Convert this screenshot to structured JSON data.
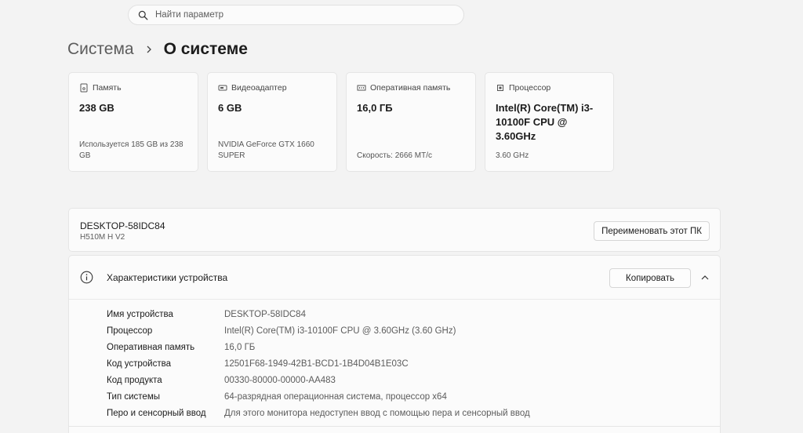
{
  "search": {
    "placeholder": "Найти параметр"
  },
  "breadcrumb": {
    "parent": "Система",
    "current": "О системе"
  },
  "cards": [
    {
      "icon": "storage-icon",
      "title": "Память",
      "value": "238 GB",
      "sub": "Используется 185 GB из 238 GB"
    },
    {
      "icon": "gpu-icon",
      "title": "Видеоадаптер",
      "value": "6 GB",
      "sub": "NVIDIA GeForce GTX 1660 SUPER"
    },
    {
      "icon": "ram-icon",
      "title": "Оперативная память",
      "value": "16,0 ГБ",
      "sub": "Скорость: 2666 МТ/с"
    },
    {
      "icon": "cpu-icon",
      "title": "Процессор",
      "value": "Intel(R) Core(TM) i3-10100F CPU @ 3.60GHz",
      "sub": "3.60 GHz"
    }
  ],
  "device": {
    "name": "DESKTOP-58IDC84",
    "model": "H510M H V2",
    "rename_label": "Переименовать этот ПК"
  },
  "specs": {
    "title": "Характеристики устройства",
    "copy_label": "Копировать",
    "rows": [
      {
        "label": "Имя устройства",
        "value": "DESKTOP-58IDC84"
      },
      {
        "label": "Процессор",
        "value": "Intel(R) Core(TM) i3-10100F CPU @ 3.60GHz (3.60 GHz)"
      },
      {
        "label": "Оперативная память",
        "value": "16,0 ГБ"
      },
      {
        "label": "Код устройства",
        "value": "12501F68-1949-42B1-BCD1-1B4D04B1E03C"
      },
      {
        "label": "Код продукта",
        "value": "00330-80000-00000-AA483"
      },
      {
        "label": "Тип системы",
        "value": "64-разрядная операционная система, процессор x64"
      },
      {
        "label": "Перо и сенсорный ввод",
        "value": "Для этого монитора недоступен ввод с помощью пера и сенсорный ввод"
      }
    ]
  },
  "colors": {
    "background": "#f3f3f3",
    "card": "#fbfbfb",
    "border": "#e5e5e5"
  }
}
